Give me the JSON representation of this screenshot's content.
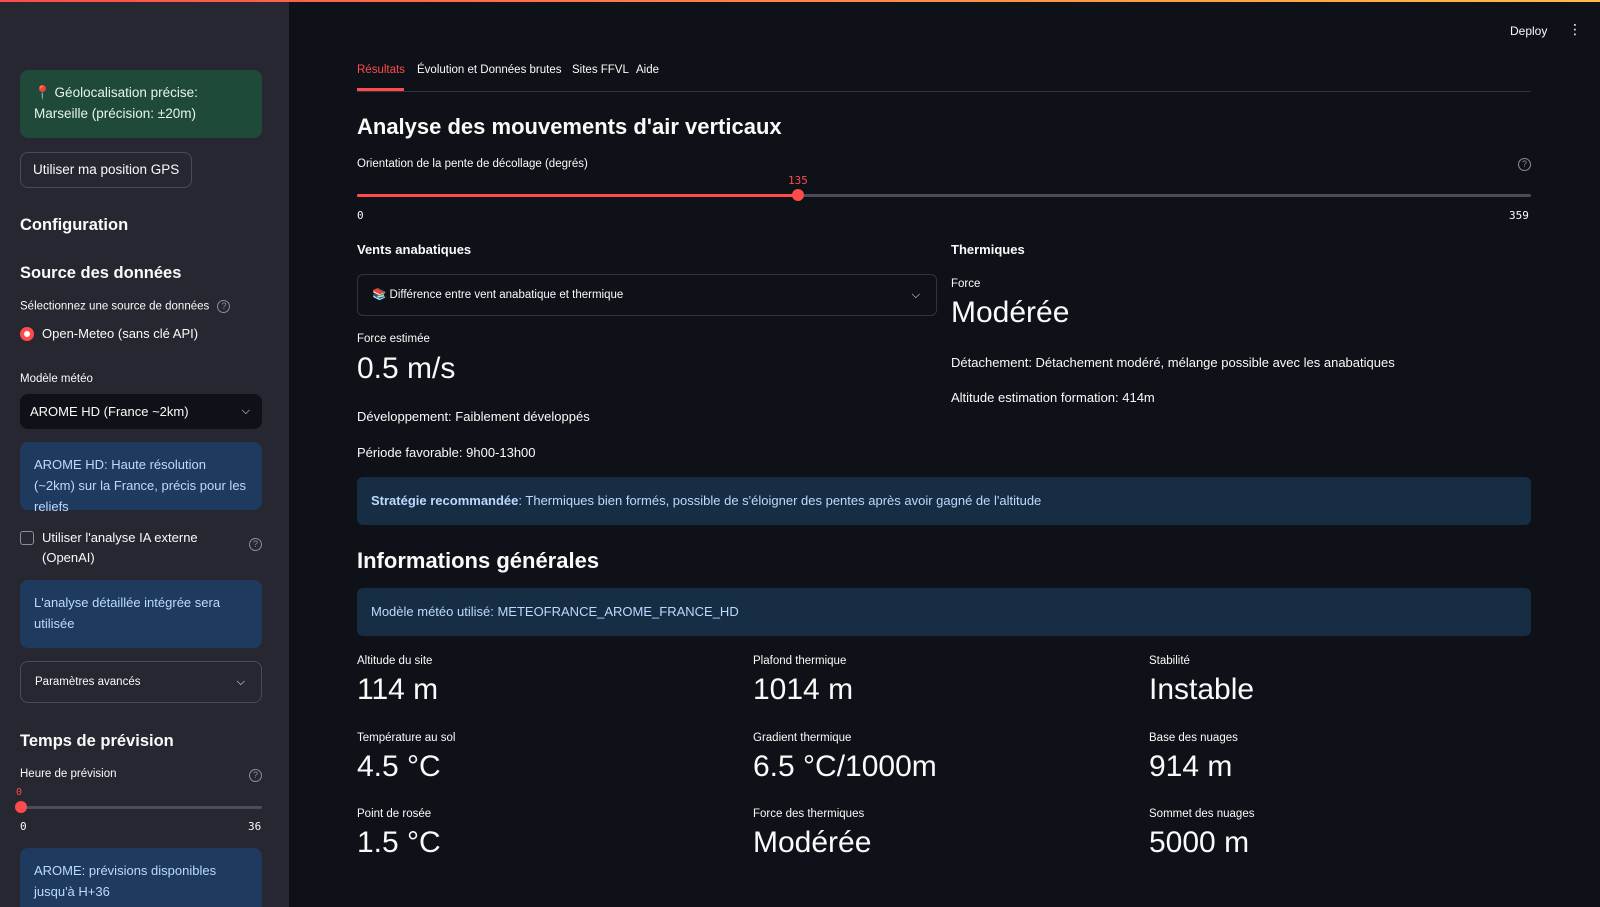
{
  "sidebar": {
    "geo_success": "📍 Géolocalisation précise: Marseille (précision: ±20m)",
    "gps_button": "Utiliser ma position GPS",
    "config_title": "Configuration",
    "source_title": "Source des données",
    "source_label": "Sélectionnez une source de données",
    "source_option": "Open-Meteo (sans clé API)",
    "model_label": "Modèle météo",
    "model_selected": "AROME HD (France ~2km)",
    "model_info": "AROME HD: Haute résolution (~2km) sur la France, précis pour les reliefs",
    "ai_checkbox_label": "Utiliser l'analyse IA externe (OpenAI)",
    "ai_info": "L'analyse détaillée intégrée sera utilisée",
    "advanced_expander": "Paramètres avancés",
    "forecast_title": "Temps de prévision",
    "forecast_label": "Heure de prévision",
    "forecast_slider": {
      "value": 0,
      "min": "0",
      "max": "36",
      "value_label": "0"
    },
    "forecast_info": "AROME: prévisions disponibles jusqu'à H+36"
  },
  "header": {
    "deploy": "Deploy",
    "menu": "⋮"
  },
  "tabs": [
    {
      "label": "Résultats",
      "active": true
    },
    {
      "label": "Évolution et Données brutes",
      "active": false
    },
    {
      "label": "Sites FFVL",
      "active": false
    },
    {
      "label": "Aide",
      "active": false
    }
  ],
  "main": {
    "title": "Analyse des mouvements d'air verticaux",
    "slope_label": "Orientation de la pente de décollage (degrés)",
    "slope_slider": {
      "value": 135,
      "min": 0,
      "max": 359,
      "value_label": "135",
      "min_label": "0",
      "max_label": "359"
    },
    "anabatic": {
      "title": "Vents anabatiques",
      "expander": "📚 Différence entre vent anabatique et thermique",
      "force_label": "Force estimée",
      "force_value": "0.5 m/s",
      "development": "Développement: Faiblement développés",
      "period": "Période favorable: 9h00-13h00"
    },
    "thermals": {
      "title": "Thermiques",
      "force_label": "Force",
      "force_value": "Modérée",
      "detachment": "Détachement: Détachement modéré, mélange possible avec les anabatiques",
      "altitude": "Altitude estimation formation: 414m"
    },
    "strategy": {
      "label": "Stratégie recommandée",
      "text": ": Thermiques bien formés, possible de s'éloigner des pentes après avoir gagné de l'altitude"
    },
    "general_title": "Informations générales",
    "model_used": "Modèle météo utilisé: METEOFRANCE_AROME_FRANCE_HD",
    "metrics": [
      {
        "label": "Altitude du site",
        "value": "114 m"
      },
      {
        "label": "Plafond thermique",
        "value": "1014 m"
      },
      {
        "label": "Stabilité",
        "value": "Instable"
      },
      {
        "label": "Température au sol",
        "value": "4.5 °C"
      },
      {
        "label": "Gradient thermique",
        "value": "6.5 °C/1000m"
      },
      {
        "label": "Base des nuages",
        "value": "914 m"
      },
      {
        "label": "Point de rosée",
        "value": "1.5 °C"
      },
      {
        "label": "Force des thermiques",
        "value": "Modérée"
      },
      {
        "label": "Sommet des nuages",
        "value": "5000 m"
      }
    ]
  },
  "colors": {
    "accent": "#ff4b4b",
    "background": "#0e1117",
    "sidebar": "#262730",
    "info": "#1e3a5f",
    "success": "#1f4a3a"
  }
}
